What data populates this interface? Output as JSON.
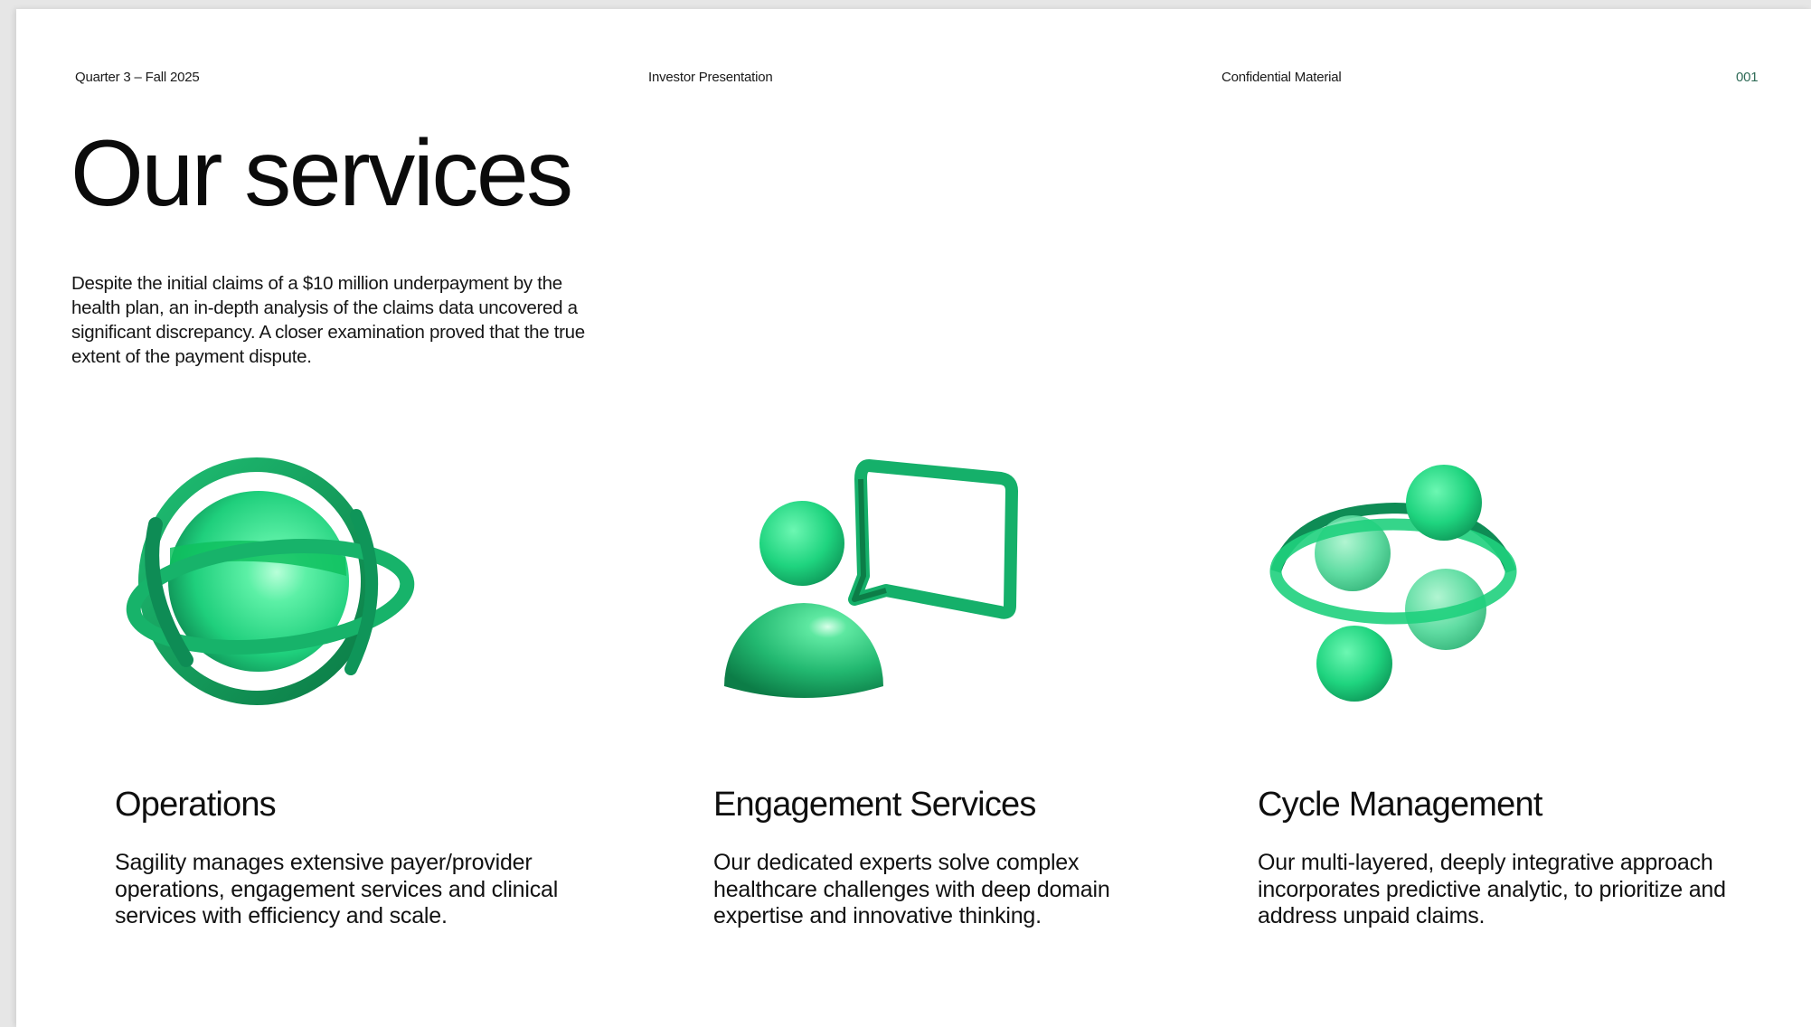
{
  "header": {
    "period": "Quarter 3 – Fall 2025",
    "deck": "Investor Presentation",
    "classification": "Confidential Material",
    "page_number": "001"
  },
  "title": "Our services",
  "intro": "Despite the initial claims of a $10 million underpayment by the health plan, an in-depth analysis of the claims data uncovered a significant discrepancy. A closer examination proved that the true extent of the payment dispute.",
  "accent_color": "#1fcf7c",
  "services": [
    {
      "title": "Operations",
      "description": "Sagility manages extensive payer/provider operations, engagement services and clinical services with efficiency and scale.",
      "icon": "globe-with-rings-icon"
    },
    {
      "title": "Engagement Services",
      "description": "Our dedicated experts solve complex healthcare challenges with deep domain expertise and innovative thinking.",
      "icon": "person-with-speech-bubble-icon"
    },
    {
      "title": "Cycle Management",
      "description": "Our multi-layered, deeply integrative approach incorporates predictive analytic, to prioritize and address unpaid claims.",
      "icon": "orbiting-spheres-icon"
    }
  ]
}
